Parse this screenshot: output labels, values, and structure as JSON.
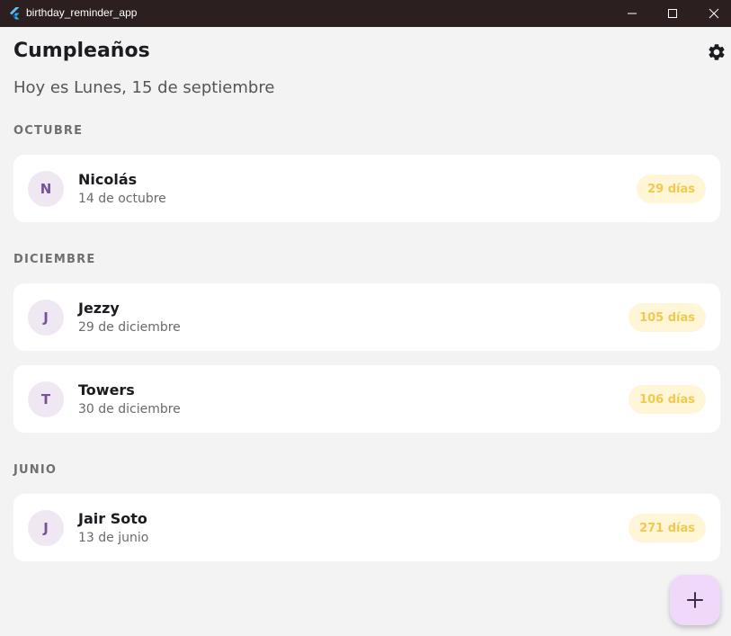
{
  "window": {
    "title": "birthday_reminder_app",
    "icon": "flutter-icon"
  },
  "header": {
    "title": "Cumpleaños",
    "settings_icon": "gear-icon",
    "date_text": "Hoy es Lunes, 15 de septiembre"
  },
  "groups": [
    {
      "month": "OCTUBRE",
      "people": [
        {
          "initial": "N",
          "name": "Nicolás",
          "date": "14 de octubre",
          "days": "29 días"
        }
      ]
    },
    {
      "month": "DICIEMBRE",
      "people": [
        {
          "initial": "J",
          "name": "Jezzy",
          "date": "29 de diciembre",
          "days": "105 días"
        },
        {
          "initial": "T",
          "name": "Towers",
          "date": "30 de diciembre",
          "days": "106 días"
        }
      ]
    },
    {
      "month": "JUNIO",
      "people": [
        {
          "initial": "J",
          "name": "Jair Soto",
          "date": "13 de junio",
          "days": "271 días"
        }
      ]
    }
  ],
  "fab": {
    "icon": "plus-icon"
  },
  "colors": {
    "titlebar": "#2b1f1f",
    "background": "#f3f3f3",
    "avatar_bg": "#efe7f2",
    "avatar_text": "#76529b",
    "badge_bg": "#fff6d8",
    "badge_text": "#f2c94c",
    "fab_bg": "#f0d8fb"
  }
}
